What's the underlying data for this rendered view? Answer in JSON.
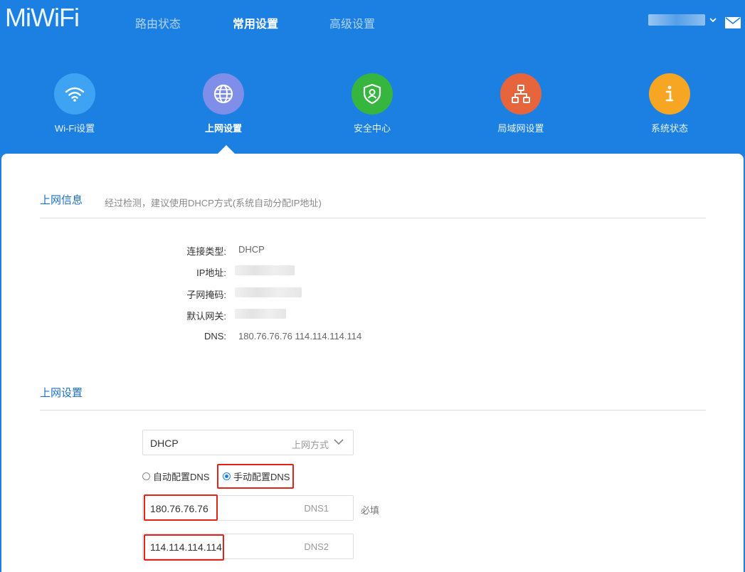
{
  "header": {
    "logo": "MiWiFi",
    "tabs": [
      {
        "label": "路由状态"
      },
      {
        "label": "常用设置"
      },
      {
        "label": "高级设置"
      }
    ]
  },
  "categories": [
    {
      "label": "Wi-Fi设置",
      "color": "#3b9ff0",
      "icon": "wifi-icon"
    },
    {
      "label": "上网设置",
      "color": "#7b8ce8",
      "icon": "globe-icon"
    },
    {
      "label": "安全中心",
      "color": "#34b53f",
      "icon": "shield-user-icon"
    },
    {
      "label": "局域网设置",
      "color": "#e5623a",
      "icon": "network-icon"
    },
    {
      "label": "系统状态",
      "color": "#f6a021",
      "icon": "info-icon"
    }
  ],
  "net_info": {
    "title": "上网信息",
    "hint": "经过检测，建议使用DHCP方式(系统自动分配IP地址)",
    "rows": [
      {
        "key": "连接类型:",
        "value": "DHCP"
      },
      {
        "key": "IP地址:",
        "value": ""
      },
      {
        "key": "子网掩码:",
        "value": ""
      },
      {
        "key": "默认网关:",
        "value": ""
      },
      {
        "key": "DNS:",
        "value": "180.76.76.76 114.114.114.114"
      }
    ]
  },
  "net_settings": {
    "title": "上网设置",
    "mode_select": {
      "value": "DHCP",
      "hint": "上网方式"
    },
    "dns_auto_label": "自动配置DNS",
    "dns_manual_label": "手动配置DNS",
    "dns1": {
      "value": "180.76.76.76",
      "suffix": "DNS1"
    },
    "dns2": {
      "value": "114.114.114.114",
      "suffix": "DNS2"
    },
    "required_label": "必填"
  },
  "colors": {
    "accent": "#1c80e2",
    "highlight": "#e2231a"
  }
}
